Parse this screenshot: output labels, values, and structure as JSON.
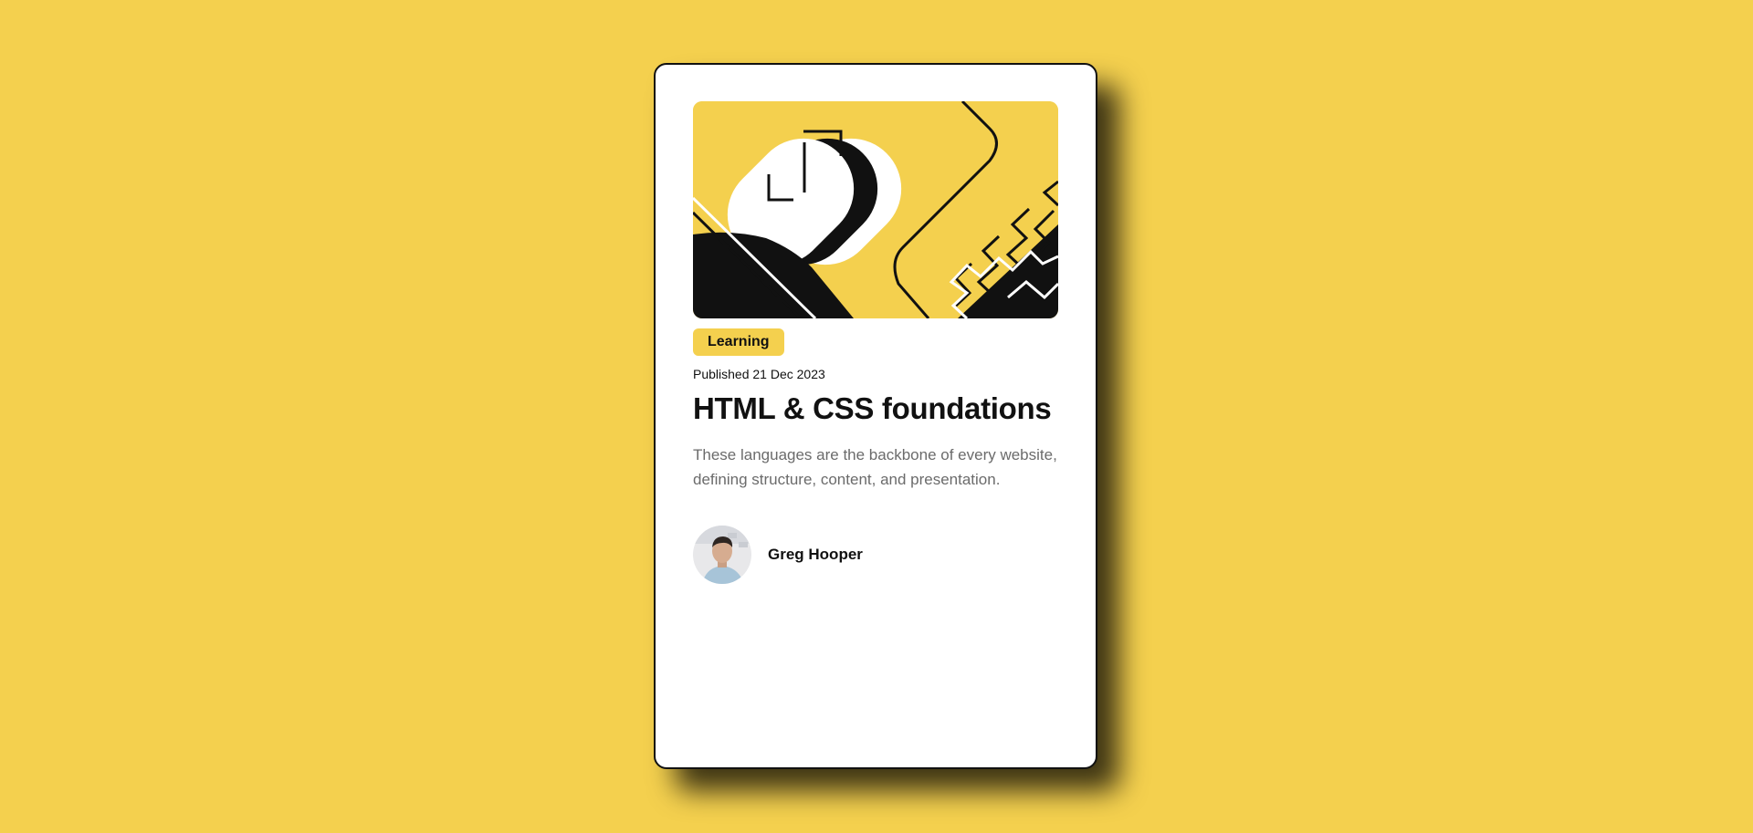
{
  "colors": {
    "background": "#F4D04E",
    "card": "#FFFFFF",
    "ink": "#111111",
    "muted": "#6B6B6B"
  },
  "card": {
    "hero_image": "abstract-illustration",
    "tag": "Learning",
    "published": "Published 21 Dec 2023",
    "title": "HTML & CSS foundations",
    "description": "These languages are the backbone of every website, defining structure, content, and presentation.",
    "author": {
      "name": "Greg Hooper",
      "avatar": "author-avatar"
    }
  }
}
